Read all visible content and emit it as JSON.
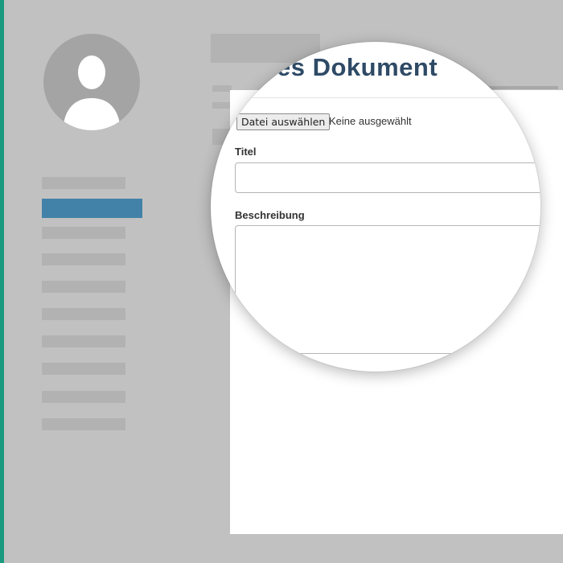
{
  "page": {
    "accent_color": "#1a9a7e",
    "active_nav_color": "#4282a8"
  },
  "sidebar": {
    "avatar_icon": "user-silhouette-icon",
    "nav_items": [
      {
        "label": "",
        "active": false
      },
      {
        "label": "",
        "active": true
      },
      {
        "label": "",
        "active": false
      },
      {
        "label": "",
        "active": false
      },
      {
        "label": "",
        "active": false
      },
      {
        "label": "",
        "active": false
      },
      {
        "label": "",
        "active": false
      },
      {
        "label": "",
        "active": false
      },
      {
        "label": "",
        "active": false
      },
      {
        "label": "",
        "active": false
      }
    ]
  },
  "form": {
    "title": "es Dokument",
    "file_button_label": "Datei auswählen",
    "file_status": "Keine ausgewählt",
    "title_label": "Titel",
    "title_value": "",
    "description_label": "Beschreibung",
    "description_value": ""
  }
}
